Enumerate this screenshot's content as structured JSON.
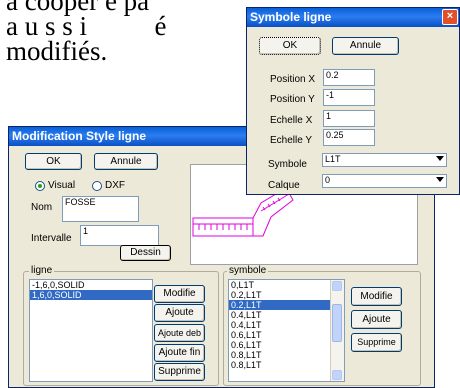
{
  "doc": {
    "line1": "à cooper e pa",
    "line2": "a u s s i          é",
    "line3": "modifiés."
  },
  "style_dialog": {
    "title": "Modification Style ligne",
    "ok_label": "OK",
    "cancel_label": "Annule",
    "radio_visual": "Visual",
    "radio_dxf": "DXF",
    "nom_label": "Nom",
    "nom_value": "FOSSE",
    "intervalle_label": "Intervalle",
    "intervalle_value": "1",
    "dessin_label": "Dessin",
    "ligne_group": "ligne",
    "ligne_items": [
      "-1,6,0,SOLID",
      "1,6,0,SOLID"
    ],
    "ligne_selected": 1,
    "ligne_buttons": [
      "Modifie",
      "Ajoute",
      "Ajoute deb",
      "Ajoute fin",
      "Supprime"
    ],
    "symbole_group": "symbole",
    "symbole_items": [
      "0,L1T",
      "0.2,L1T",
      "0.2,L1T",
      "0.4,L1T",
      "0.4,L1T",
      "0.6,L1T",
      "0.6,L1T",
      "0.8,L1T",
      "0.8,L1T"
    ],
    "symbole_selected": 2,
    "symbole_buttons": [
      "Modifie",
      "Ajoute",
      "Supprime"
    ]
  },
  "symbol_dialog": {
    "title": "Symbole ligne",
    "close_glyph": "×",
    "ok_label": "OK",
    "cancel_label": "Annule",
    "position_x_label": "Position X",
    "position_x_value": "0.2",
    "position_y_label": "Position Y",
    "position_y_value": "-1",
    "echelle_x_label": "Echelle X",
    "echelle_x_value": "1",
    "echelle_y_label": "Echelle Y",
    "echelle_y_value": "0.25",
    "symbole_label": "Symbole",
    "symbole_value": "L1T",
    "calque_label": "Calque",
    "calque_value": "0"
  },
  "colors": {
    "preview_line": "#e000e0",
    "selection": "#316ac5",
    "title_bar": "#0a5fd8"
  }
}
